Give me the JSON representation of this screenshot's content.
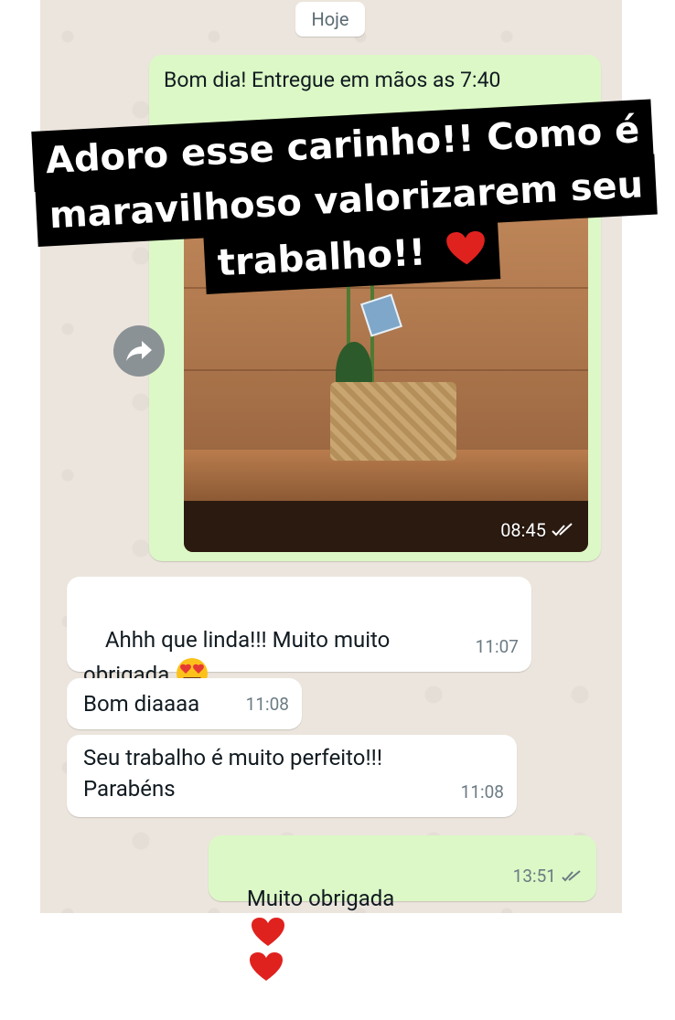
{
  "date_chip": "Hoje",
  "image_message": {
    "caption": "Bom dia! Entregue em mãos as 7:40",
    "time": "08:45"
  },
  "overlay": {
    "line1": "Adoro esse carinho!! Como é",
    "line2": "maravilhoso valorizarem seu",
    "line3": "trabalho!!",
    "emoji": "red-heart-icon"
  },
  "messages": [
    {
      "direction": "in",
      "text": "Ahhh que linda!!! Muito muito\nobrigada",
      "emoji": "heart-eyes-icon",
      "time": "11:07"
    },
    {
      "direction": "in",
      "text": "Bom diaaaa",
      "time": "11:08"
    },
    {
      "direction": "in",
      "text": "Seu trabalho é muito perfeito!!!\nParabéns",
      "time": "11:08"
    },
    {
      "direction": "out",
      "text": "Muito obrigada",
      "emoji": "red-heart-icon",
      "time": "13:51"
    }
  ],
  "colors": {
    "chat_background": "#ece5dd",
    "outgoing_bubble": "#dcf8c6",
    "incoming_bubble": "#ffffff",
    "read_ticks": "#6b7b83"
  }
}
